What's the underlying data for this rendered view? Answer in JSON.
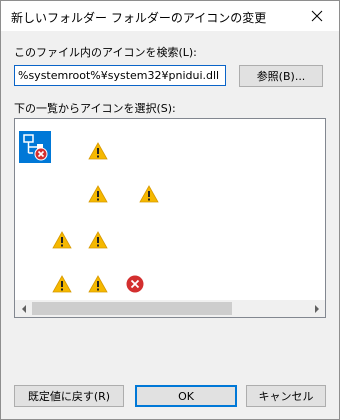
{
  "dialog": {
    "title": "新しいフォルダー フォルダーのアイコンの変更"
  },
  "search": {
    "label": "このファイル内のアイコンを検索(L):",
    "path_value": "%systemroot%¥system32¥pnidui.dll",
    "browse_label": "参照(B)..."
  },
  "icon_list": {
    "label": "下の一覧からアイコンを選択(S):",
    "icons": [
      {
        "name": "network-error-icon",
        "selected": true
      },
      {
        "name": "warning-icon"
      },
      {
        "name": "warning-icon"
      },
      {
        "name": "warning-icon"
      },
      {
        "name": "warning-icon"
      },
      {
        "name": "warning-icon"
      },
      {
        "name": "warning-icon"
      },
      {
        "name": "warning-icon"
      },
      {
        "name": "error-icon"
      }
    ]
  },
  "buttons": {
    "restore_label": "既定値に戻す(R)",
    "ok_label": "OK",
    "cancel_label": "キャンセル"
  },
  "colors": {
    "accent": "#0078d7",
    "warning": "#f5b800",
    "error": "#d32f2f"
  }
}
